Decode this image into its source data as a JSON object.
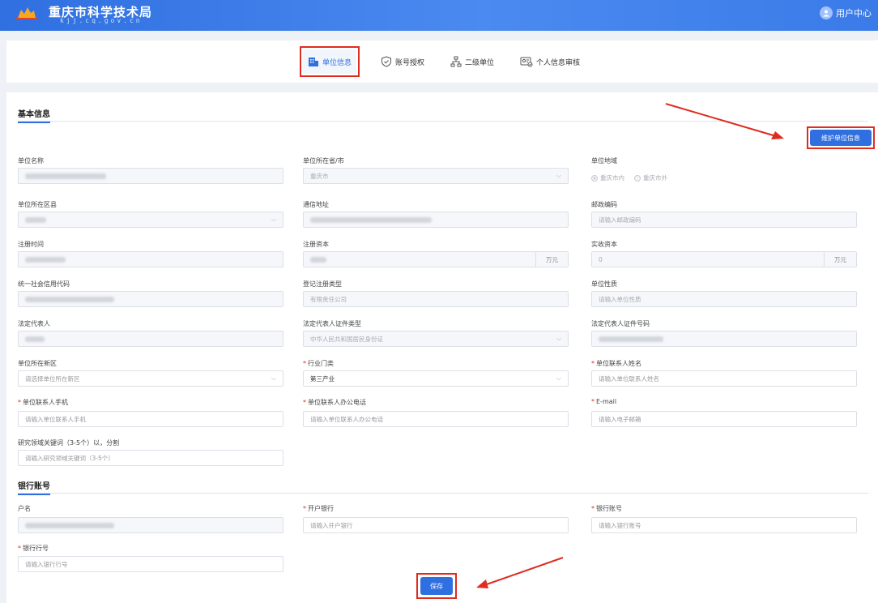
{
  "header": {
    "site_title": "重庆市科学技术局",
    "site_domain": "kjj.cq.gov.cn",
    "user_center": "用户中心"
  },
  "tabs": [
    {
      "label": "单位信息",
      "icon": "building-icon",
      "active": true
    },
    {
      "label": "账号授权",
      "icon": "shield-check-icon",
      "active": false
    },
    {
      "label": "二级单位",
      "icon": "org-chart-icon",
      "active": false
    },
    {
      "label": "个人信息审核",
      "icon": "id-card-check-icon",
      "active": false
    }
  ],
  "basic": {
    "title": "基本信息",
    "maintain_button": "维护单位信息",
    "unit_name": {
      "label": "单位名称"
    },
    "province": {
      "label": "单位所在省/市",
      "value": "重庆市"
    },
    "region": {
      "label": "单位地域",
      "opt_in": "重庆市内",
      "opt_out": "重庆市外"
    },
    "district": {
      "label": "单位所在区县"
    },
    "address": {
      "label": "通信地址"
    },
    "postcode": {
      "label": "邮政编码",
      "placeholder": "请输入邮政编码"
    },
    "reg_time": {
      "label": "注册时间"
    },
    "reg_capital": {
      "label": "注册资本",
      "unit": "万元"
    },
    "paid_capital": {
      "label": "实收资本",
      "value": "0",
      "unit": "万元"
    },
    "credit_code": {
      "label": "统一社会信用代码"
    },
    "reg_type": {
      "label": "登记注册类型",
      "value": "有限责任公司"
    },
    "unit_nature": {
      "label": "单位性质",
      "placeholder": "请输入单位性质"
    },
    "legal_rep": {
      "label": "法定代表人"
    },
    "legal_id_type": {
      "label": "法定代表人证件类型",
      "value": "中华人民共和国居民身份证"
    },
    "legal_id_no": {
      "label": "法定代表人证件号码"
    },
    "new_area": {
      "label": "单位所在新区",
      "placeholder": "请选择单位所在新区"
    },
    "industry": {
      "label": "行业门类",
      "value": "第三产业"
    },
    "contact_name": {
      "label": "单位联系人姓名",
      "placeholder": "请输入单位联系人姓名"
    },
    "contact_phone": {
      "label": "单位联系人手机",
      "placeholder": "请输入单位联系人手机"
    },
    "office_phone": {
      "label": "单位联系人办公电话",
      "placeholder": "请输入单位联系人办公电话"
    },
    "email": {
      "label": "E-mail",
      "placeholder": "请输入电子邮箱"
    },
    "keywords": {
      "label": "研究领域关键词（3-5个）以，分割",
      "placeholder": "请输入研究领域关键词（3-5个）"
    }
  },
  "bank": {
    "title": "银行账号",
    "account_name": {
      "label": "户名"
    },
    "bank_name": {
      "label": "开户银行",
      "placeholder": "请输入开户银行"
    },
    "account_no": {
      "label": "银行账号",
      "placeholder": "请输入银行账号"
    },
    "bank_code": {
      "label": "银行行号",
      "placeholder": "请输入银行行号"
    }
  },
  "save_button": "保存",
  "colors": {
    "primary": "#2f6fe0",
    "annotation": "#e02b20",
    "required": "#e02b20"
  }
}
